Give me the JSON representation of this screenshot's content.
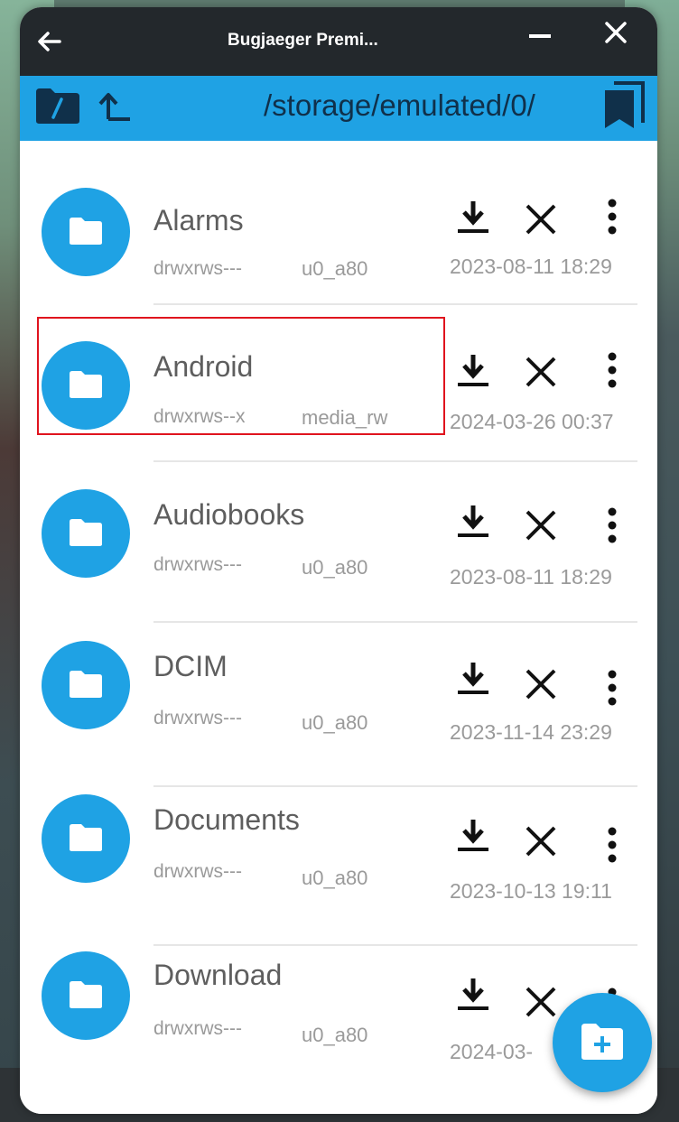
{
  "window": {
    "title": "Bugjaeger Premi...",
    "back_icon": "arrow-left-icon",
    "minimize_icon": "minimize-icon",
    "close_icon": "close-icon"
  },
  "toolbar": {
    "path": "/storage/emulated/0/",
    "root_icon": "root-folder-icon",
    "up_icon": "up-arrow-icon",
    "bookmark_icon": "bookmark-icon"
  },
  "files": [
    {
      "name": "Alarms",
      "permissions": "drwxrws---",
      "owner": "u0_a80",
      "modified": "2023-08-11 18:29"
    },
    {
      "name": "Android",
      "permissions": "drwxrws--x",
      "owner": "media_rw",
      "modified": "2024-03-26 00:37"
    },
    {
      "name": "Audiobooks",
      "permissions": "drwxrws---",
      "owner": "u0_a80",
      "modified": "2023-08-11 18:29"
    },
    {
      "name": "DCIM",
      "permissions": "drwxrws---",
      "owner": "u0_a80",
      "modified": "2023-11-14 23:29"
    },
    {
      "name": "Documents",
      "permissions": "drwxrws---",
      "owner": "u0_a80",
      "modified": "2023-10-13 19:11"
    },
    {
      "name": "Download",
      "permissions": "drwxrws---",
      "owner": "u0_a80",
      "modified": "2024-03-"
    }
  ],
  "row_icons": {
    "download": "download-icon",
    "delete": "close-x-icon",
    "more": "more-vert-icon",
    "folder": "folder-icon"
  },
  "fab": {
    "icon": "new-folder-icon"
  },
  "colors": {
    "accent": "#1fa2e4",
    "titlebar": "#23282c",
    "highlight": "#e0141e"
  }
}
